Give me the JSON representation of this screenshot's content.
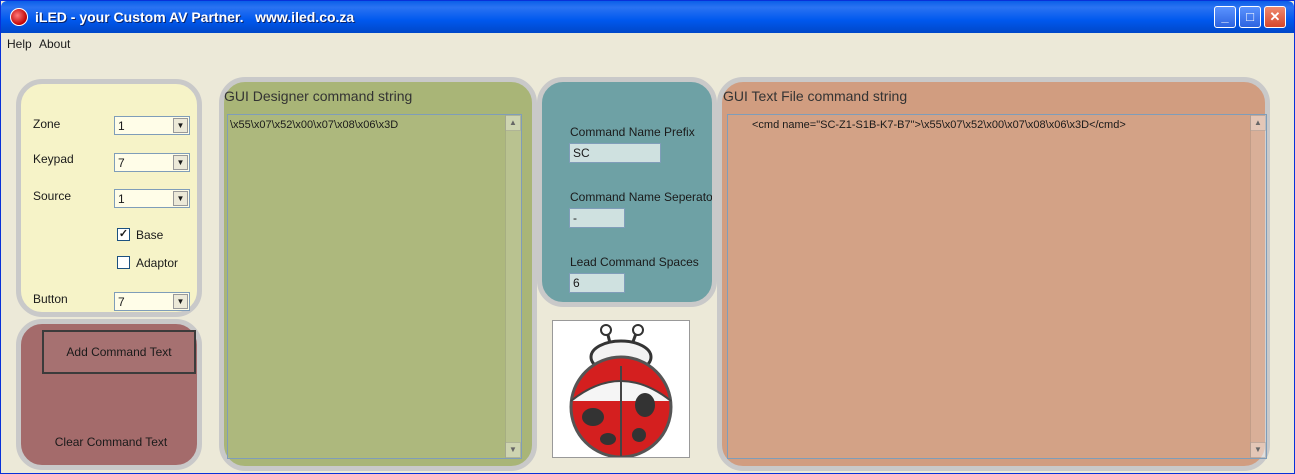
{
  "window": {
    "title": "iLED - your Custom AV Partner.   www.iled.co.za",
    "minimize": "_",
    "maximize": "□",
    "close": "✕"
  },
  "menu": {
    "help": "Help",
    "about": "About"
  },
  "options": {
    "zone_label": "Zone",
    "zone_value": "1",
    "keypad_label": "Keypad",
    "keypad_value": "7",
    "source_label": "Source",
    "source_value": "1",
    "base_label": "Base",
    "base_checked": true,
    "adaptor_label": "Adaptor",
    "adaptor_checked": false,
    "button_label": "Button",
    "button_value": "7"
  },
  "actions": {
    "add_label": "Add Command Text",
    "clear_label": "Clear Command Text"
  },
  "gui_designer": {
    "title": "GUI Designer command string",
    "content": "\\x55\\x07\\x52\\x00\\x07\\x08\\x06\\x3D"
  },
  "settings": {
    "prefix_label": "Command Name Prefix",
    "prefix_value": "SC",
    "separator_label": "Command Name Seperator",
    "separator_value": "-",
    "lead_label": "Lead Command Spaces",
    "lead_value": "6"
  },
  "text_file": {
    "title": "GUI Text File command string",
    "content": "<cmd name=\"SC-Z1-S1B-K7-B7\">\\x55\\x07\\x52\\x00\\x07\\x08\\x06\\x3D</cmd>"
  },
  "icons": {
    "app": "ladybug-icon",
    "logo": "ladybug-logo"
  },
  "colors": {
    "titlebar": "#0058ee",
    "options_panel": "#f6f3c8",
    "actions_panel": "#a46b6b",
    "gui_panel": "#a9b577",
    "settings_panel": "#6ea1a5",
    "file_panel": "#d19d80"
  }
}
